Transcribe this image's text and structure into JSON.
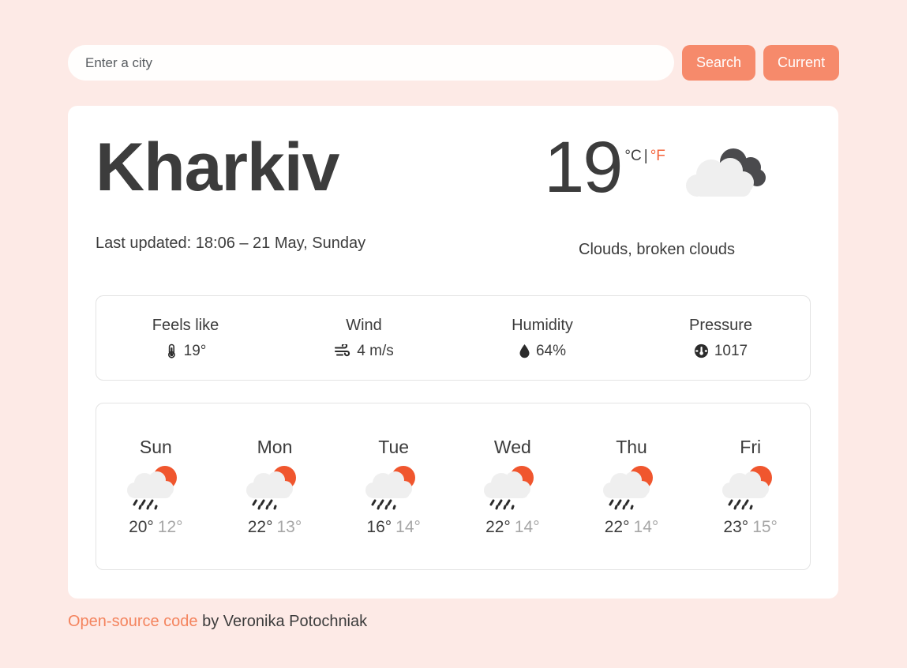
{
  "search": {
    "placeholder": "Enter a city",
    "value": "",
    "search_label": "Search",
    "current_label": "Current"
  },
  "current": {
    "city": "Kharkiv",
    "last_updated": "Last updated: 18:06 – 21 May, Sunday",
    "temperature": "19",
    "unit_celsius": "°C",
    "unit_separator": "|",
    "unit_fahrenheit": "°F",
    "condition": "Clouds, broken clouds",
    "icon": "broken-clouds-icon"
  },
  "details": [
    {
      "label": "Feels like",
      "value": "19°",
      "icon": "thermometer-icon"
    },
    {
      "label": "Wind",
      "value": "4 m/s",
      "icon": "wind-icon"
    },
    {
      "label": "Humidity",
      "value": "64%",
      "icon": "water-drop-icon"
    },
    {
      "label": "Pressure",
      "value": "1017",
      "icon": "gauge-icon"
    }
  ],
  "forecast": [
    {
      "day": "Sun",
      "max": "20°",
      "min": "12°",
      "icon": "sun-cloud-rain-icon"
    },
    {
      "day": "Mon",
      "max": "22°",
      "min": "13°",
      "icon": "sun-cloud-rain-icon"
    },
    {
      "day": "Tue",
      "max": "16°",
      "min": "14°",
      "icon": "sun-cloud-rain-icon"
    },
    {
      "day": "Wed",
      "max": "22°",
      "min": "14°",
      "icon": "sun-cloud-rain-icon"
    },
    {
      "day": "Thu",
      "max": "22°",
      "min": "14°",
      "icon": "sun-cloud-rain-icon"
    },
    {
      "day": "Fri",
      "max": "23°",
      "min": "15°",
      "icon": "sun-cloud-rain-icon"
    }
  ],
  "footer": {
    "link_text": "Open-source code",
    "rest_text": " by Veronika Potochniak"
  },
  "colors": {
    "page_background": "#fdeae6",
    "card_background": "#ffffff",
    "accent": "#f68a6b",
    "link": "#f4845e",
    "unit_link": "#f4633a",
    "text": "#3c3c3c",
    "muted_text": "#a6a6a6",
    "sun_orange": "#f0562e",
    "cloud_light": "#efefef",
    "cloud_dark": "#4a4a4d"
  }
}
